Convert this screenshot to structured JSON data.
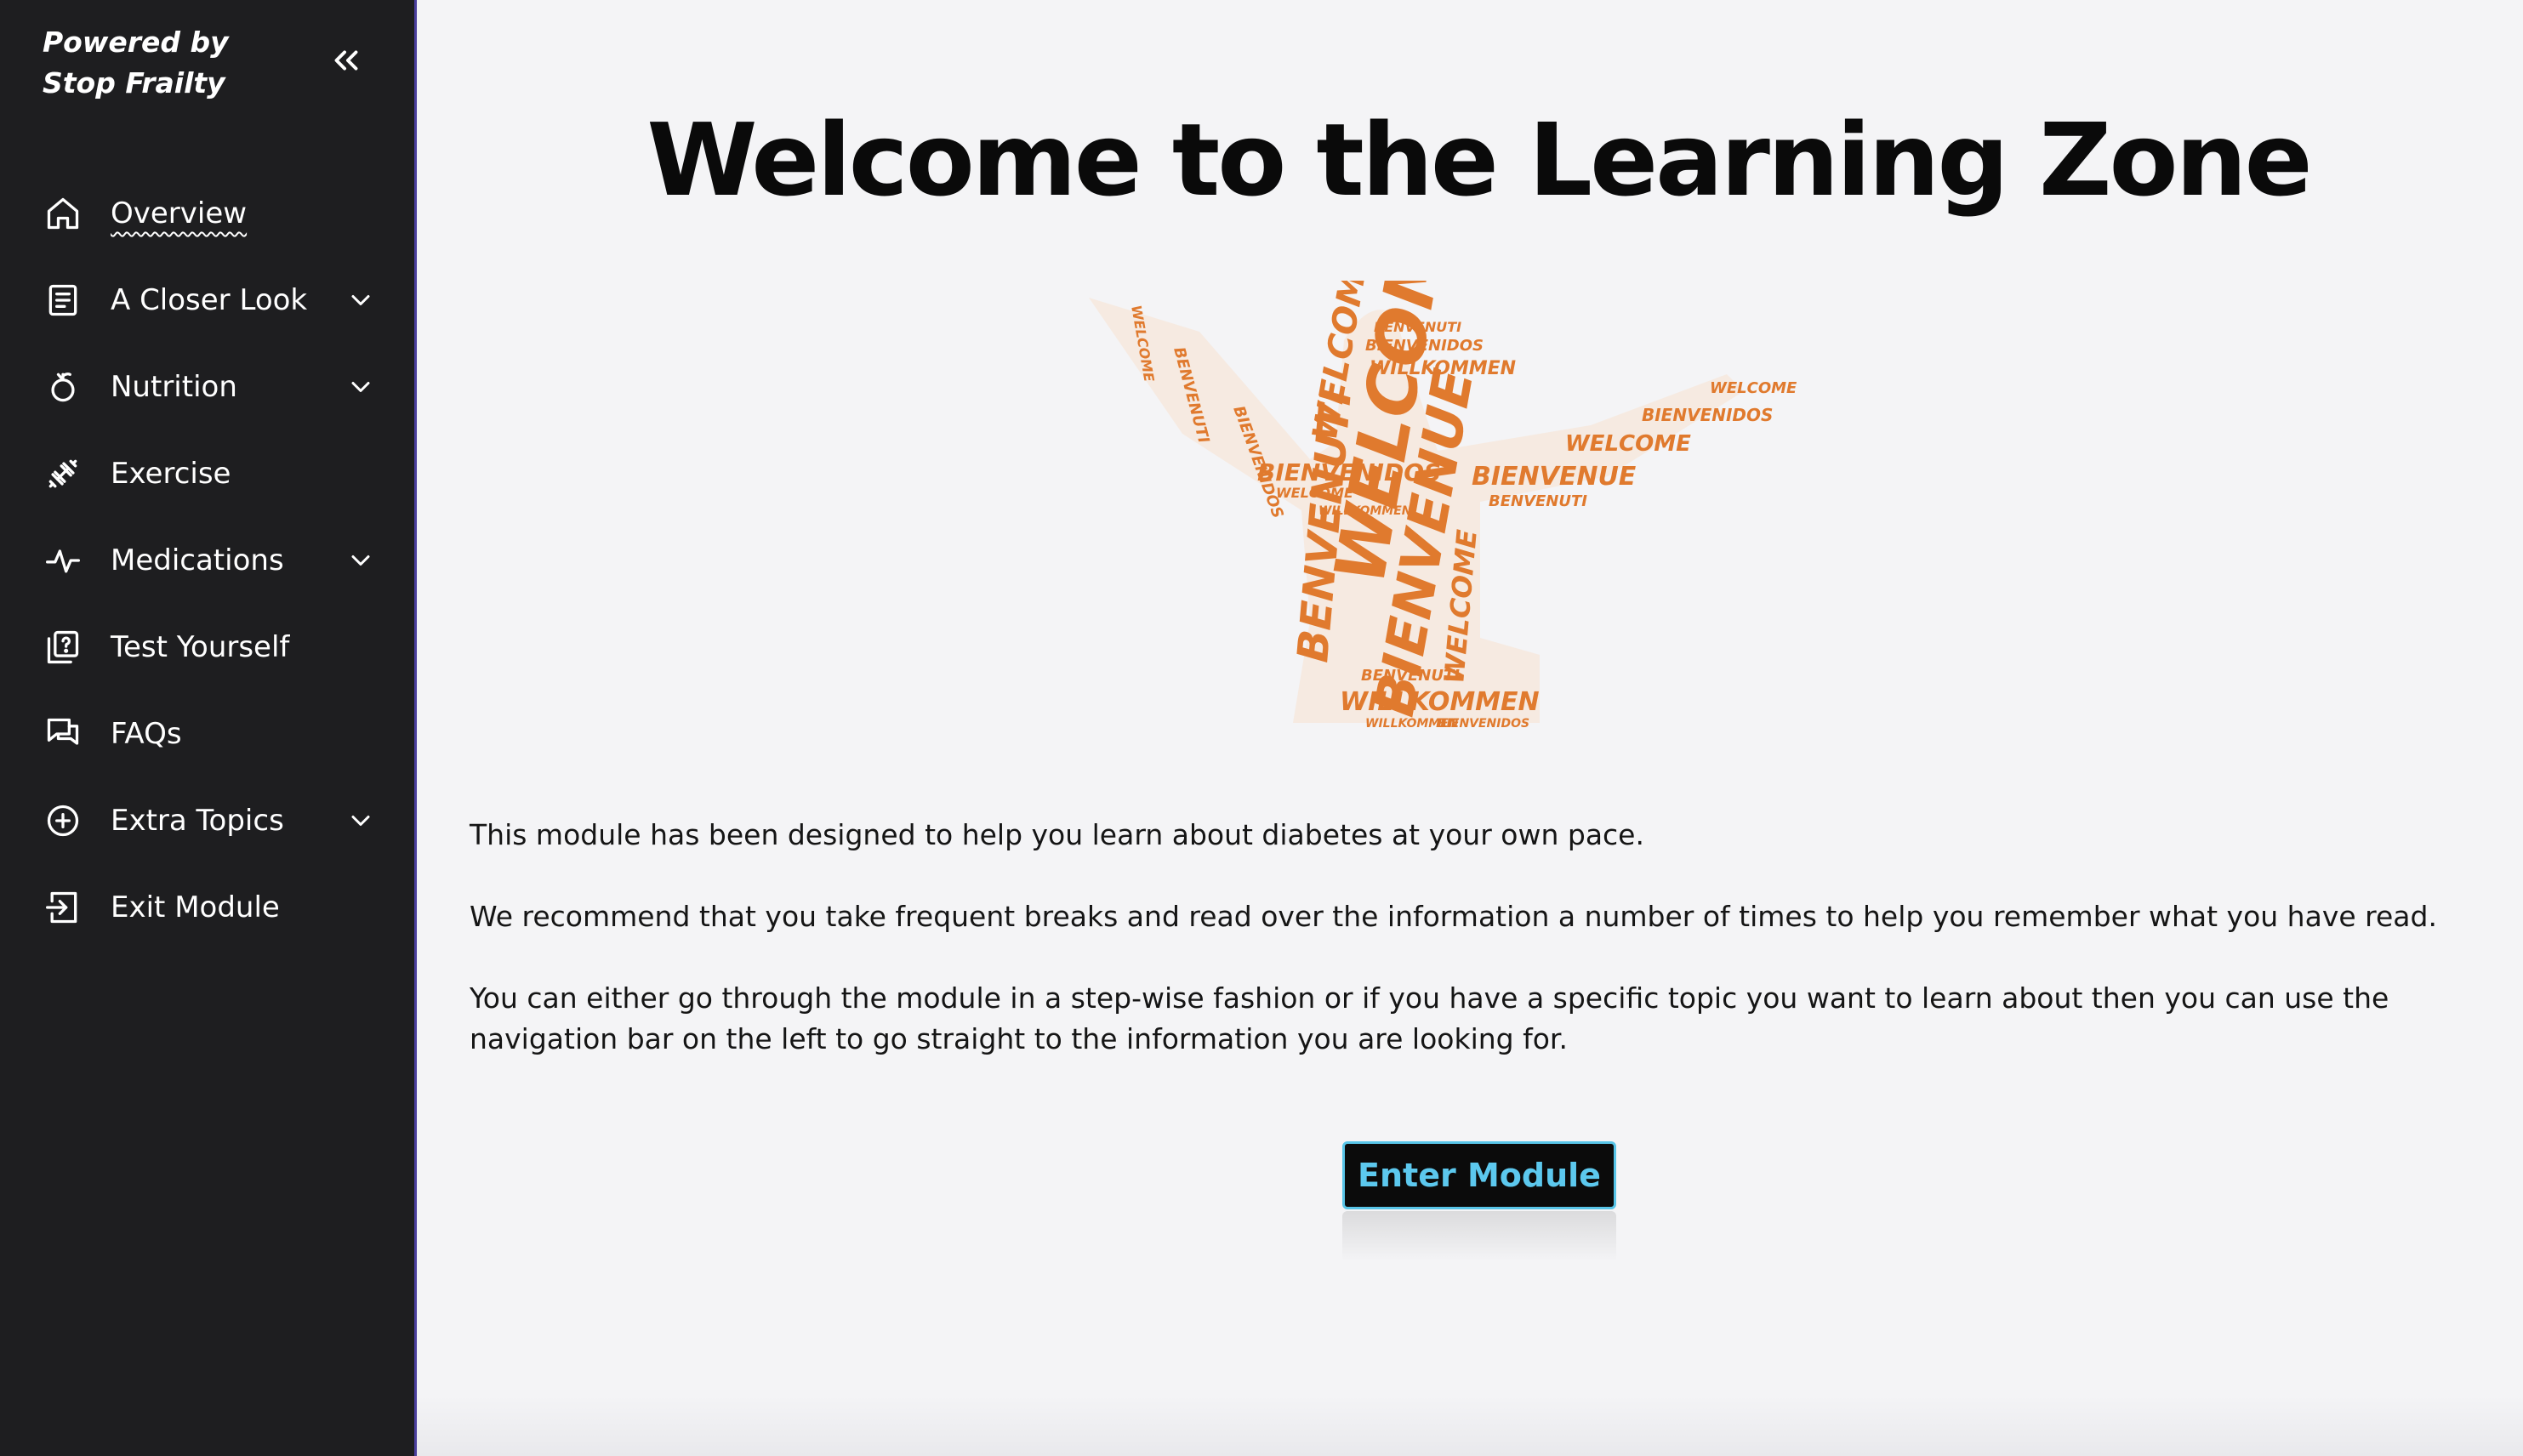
{
  "sidebar": {
    "brand_line1": "Powered by",
    "brand_line2": "Stop Frailty",
    "collapse_icon": "double-chevron-left-icon",
    "items": [
      {
        "label": "Overview",
        "icon": "home-icon",
        "expandable": false,
        "active": true
      },
      {
        "label": "A Closer Look",
        "icon": "document-icon",
        "expandable": true
      },
      {
        "label": "Nutrition",
        "icon": "apple-icon",
        "expandable": true
      },
      {
        "label": "Exercise",
        "icon": "dumbbell-icon",
        "expandable": false
      },
      {
        "label": "Medications",
        "icon": "activity-pulse-icon",
        "expandable": true
      },
      {
        "label": "Test Yourself",
        "icon": "quiz-icon",
        "expandable": false
      },
      {
        "label": "FAQs",
        "icon": "chat-icon",
        "expandable": false
      },
      {
        "label": "Extra Topics",
        "icon": "plus-circle-icon",
        "expandable": true
      },
      {
        "label": "Exit Module",
        "icon": "exit-icon",
        "expandable": false
      }
    ]
  },
  "main": {
    "title": "Welcome to the Learning Zone",
    "hero_words": [
      "WELCOME",
      "BIENVENUE",
      "BENVENUTI",
      "WILLKOMMEN",
      "BIENVENIDOS"
    ],
    "paragraphs": [
      "This module has been designed to help you learn about diabetes at your own pace.",
      "We recommend that you take frequent breaks and read over the information a number of times to help you remember what you have read.",
      "You can either go through the module in a step-wise fashion or if you have a specific topic you want to learn about then you can use the navigation bar on the left to go straight to the information you are looking for."
    ],
    "enter_button": "Enter Module"
  },
  "colors": {
    "sidebar_bg": "#1e1e20",
    "accent_orange": "#e07a2e",
    "button_text": "#5cc8ee",
    "page_bg": "#f4f4f6"
  }
}
